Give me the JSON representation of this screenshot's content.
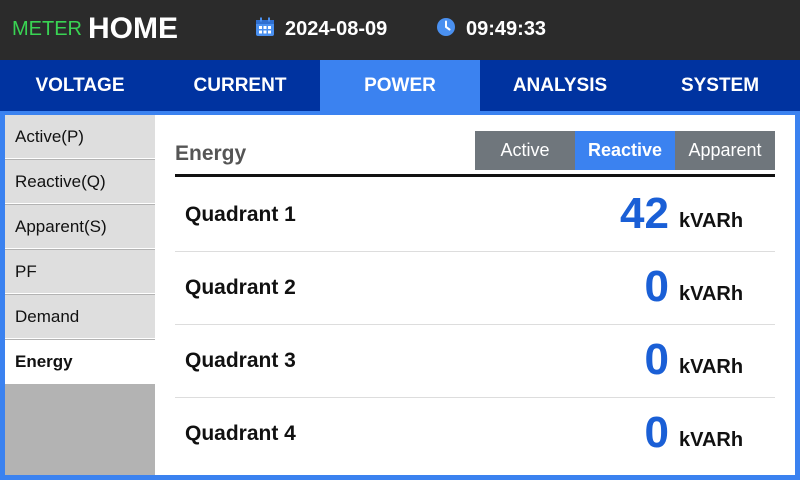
{
  "header": {
    "brand_small": "METER",
    "brand_big": "HOME",
    "date": "2024-08-09",
    "time": "09:49:33",
    "icons": {
      "date": "calendar-icon",
      "time": "clock-icon"
    },
    "colors": {
      "brand_small": "#39d353",
      "bar": "#2b2b2b"
    }
  },
  "tabs": [
    {
      "label": "VOLTAGE",
      "active": false
    },
    {
      "label": "CURRENT",
      "active": false
    },
    {
      "label": "POWER",
      "active": true
    },
    {
      "label": "ANALYSIS",
      "active": false
    },
    {
      "label": "SYSTEM",
      "active": false
    }
  ],
  "sidebar": {
    "items": [
      {
        "label": "Active(P)",
        "active": false
      },
      {
        "label": "Reactive(Q)",
        "active": false
      },
      {
        "label": "Apparent(S)",
        "active": false
      },
      {
        "label": "PF",
        "active": false
      },
      {
        "label": "Demand",
        "active": false
      },
      {
        "label": "Energy",
        "active": true
      }
    ]
  },
  "content": {
    "title": "Energy",
    "segments": [
      {
        "label": "Active",
        "active": false
      },
      {
        "label": "Reactive",
        "active": true
      },
      {
        "label": "Apparent",
        "active": false
      }
    ],
    "rows": [
      {
        "label": "Quadrant 1",
        "value": "42",
        "unit": "kVARh"
      },
      {
        "label": "Quadrant 2",
        "value": "0",
        "unit": "kVARh"
      },
      {
        "label": "Quadrant 3",
        "value": "0",
        "unit": "kVARh"
      },
      {
        "label": "Quadrant 4",
        "value": "0",
        "unit": "kVARh"
      }
    ]
  },
  "colors": {
    "accent": "#3b82f0",
    "tab_bar": "#0033a0",
    "value": "#1a5fd6"
  }
}
